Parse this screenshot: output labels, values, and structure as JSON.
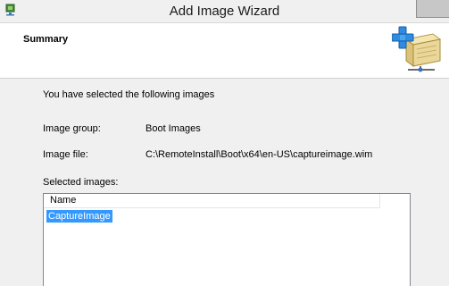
{
  "window": {
    "title": "Add Image Wizard"
  },
  "header": {
    "title": "Summary",
    "icon": "server-add-icon"
  },
  "summary": {
    "intro": "You have selected the following images",
    "image_group_label": "Image group:",
    "image_group_value": "Boot Images",
    "image_file_label": "Image file:",
    "image_file_value": "C:\\RemoteInstall\\Boot\\x64\\en-US\\captureimage.wim",
    "selected_images_label": "Selected images:"
  },
  "images_list": {
    "columns": [
      "Name"
    ],
    "rows": [
      {
        "name": "CaptureImage",
        "selected": true
      }
    ]
  },
  "colors": {
    "selection": "#3399ff",
    "close_button": "#c7c7c7"
  }
}
